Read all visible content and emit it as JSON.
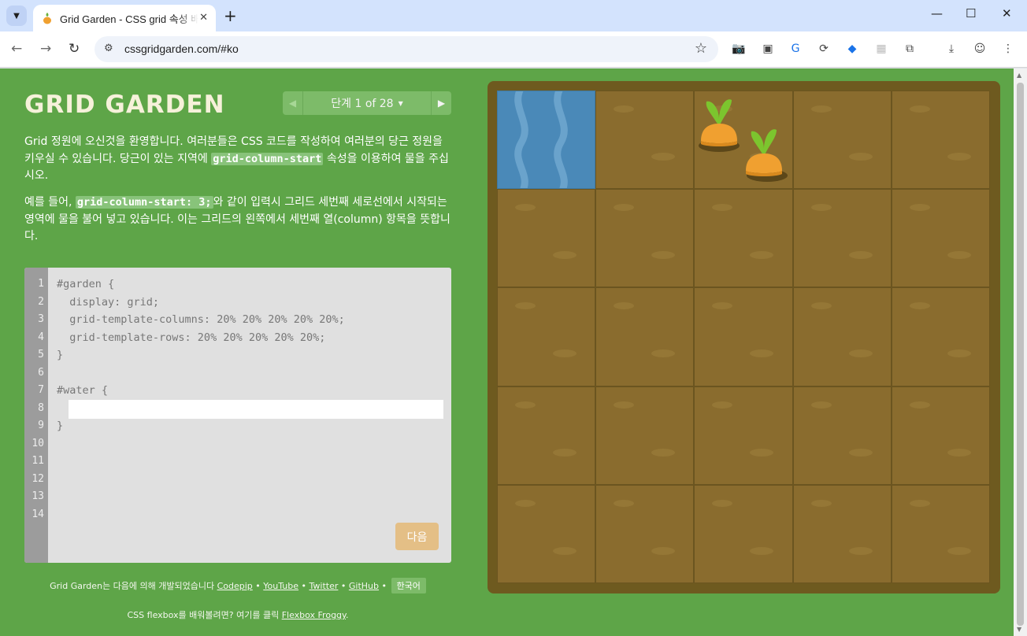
{
  "browser": {
    "tab_title": "Grid Garden - CSS grid 속성 배우기",
    "url": "cssgridgarden.com/#ko",
    "new_tab": "+",
    "minimize": "—",
    "maximize": "☐",
    "close": "✕"
  },
  "game": {
    "logo": "GRID GARDEN",
    "level": {
      "label": "단계 1 of 28",
      "current": 1,
      "total": 28
    },
    "instructions": {
      "p1_before": "Grid 정원에 오신것을 환영합니다. 여러분들은 CSS 코드를 작성하여 여러분의 당근 정원을 키우실 수 있습니다. 당근이 있는 지역에 ",
      "p1_code": "grid-column-start",
      "p1_after": " 속성을 이용하여 물을 주십시오.",
      "p2_before": "예를 들어, ",
      "p2_code": "grid-column-start: 3;",
      "p2_after": "와 같이 입력시 그리드 세번째 세로선에서 시작되는 영역에 물을 불어 넣고 있습니다. 이는 그리드의 왼쪽에서 세번째 열(column) 항목을 뜻합니다."
    },
    "editor": {
      "line_numbers": [
        "1",
        "2",
        "3",
        "4",
        "5",
        "6",
        "7",
        "8",
        "9",
        "10",
        "11",
        "12",
        "13",
        "14"
      ],
      "lines": [
        "#garden {",
        "  display: grid;",
        "  grid-template-columns: 20% 20% 20% 20% 20%;",
        "  grid-template-rows: 20% 20% 20% 20% 20%;",
        "}",
        "",
        "#water {",
        "",
        "}"
      ],
      "input_value": "",
      "next_button": "다음"
    },
    "credits": {
      "text": "Grid Garden는 다음에 의해 개발되었습니다",
      "codepip": "Codepip",
      "youtube": "YouTube",
      "twitter": "Twitter",
      "github": "GitHub",
      "sep": "•",
      "language": "한국어",
      "froggy_text": "CSS flexbox를 배워볼려면? 여기를 클릭",
      "froggy_link": "Flexbox Froggy",
      "froggy_period": "."
    },
    "garden": {
      "columns": 5,
      "rows": 5,
      "water_cell": {
        "column": 1,
        "row": 1
      },
      "carrots": [
        {
          "column": 3,
          "row": 1
        },
        {
          "column": 3,
          "row": 1
        }
      ]
    }
  },
  "colors": {
    "page_bg": "#5ea548",
    "soil": "#8a6c2e",
    "water": "#4a89b8",
    "frame": "#6e5a1f",
    "carrot": "#f0a030",
    "leaf": "#7cc52e"
  }
}
